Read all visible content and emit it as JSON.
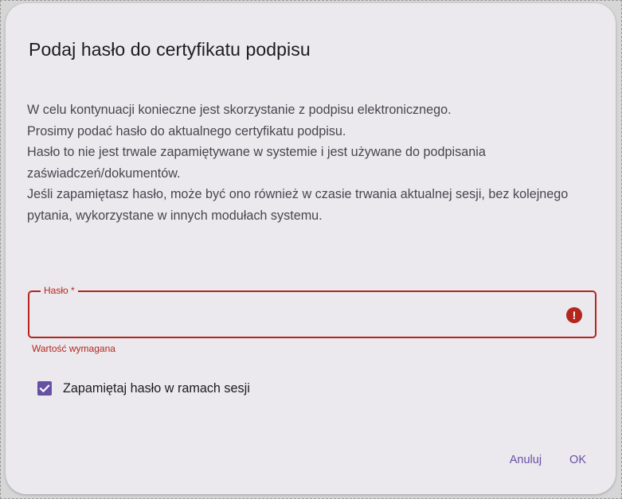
{
  "dialog": {
    "title": "Podaj hasło do certyfikatu podpisu",
    "body_lines": [
      "W celu kontynuacji konieczne jest skorzystanie z podpisu elektronicznego.",
      "Prosimy podać hasło do aktualnego certyfikatu podpisu.",
      "Hasło to nie jest trwale zapamiętywane w systemie i jest używane do podpisania zaświadczeń/dokumentów.",
      "Jeśli zapamiętasz hasło, może być ono również w czasie trwania aktualnej sesji, bez kolejnego pytania, wykorzystane w innych modułach systemu."
    ],
    "password_field": {
      "label": "Hasło *",
      "value": "",
      "error_text": "Wartość wymagana",
      "error_icon": "error-circle-icon",
      "state": "error"
    },
    "remember": {
      "label": "Zapamiętaj hasło w ramach sesji",
      "checked": true
    },
    "buttons": {
      "cancel_label": "Anuluj",
      "ok_label": "OK"
    }
  },
  "colors": {
    "dialog_background": "#ebe9ee",
    "error": "#b3261e",
    "accent": "#6750a4",
    "title_text": "#1c1b1f",
    "body_text": "#49454f"
  }
}
